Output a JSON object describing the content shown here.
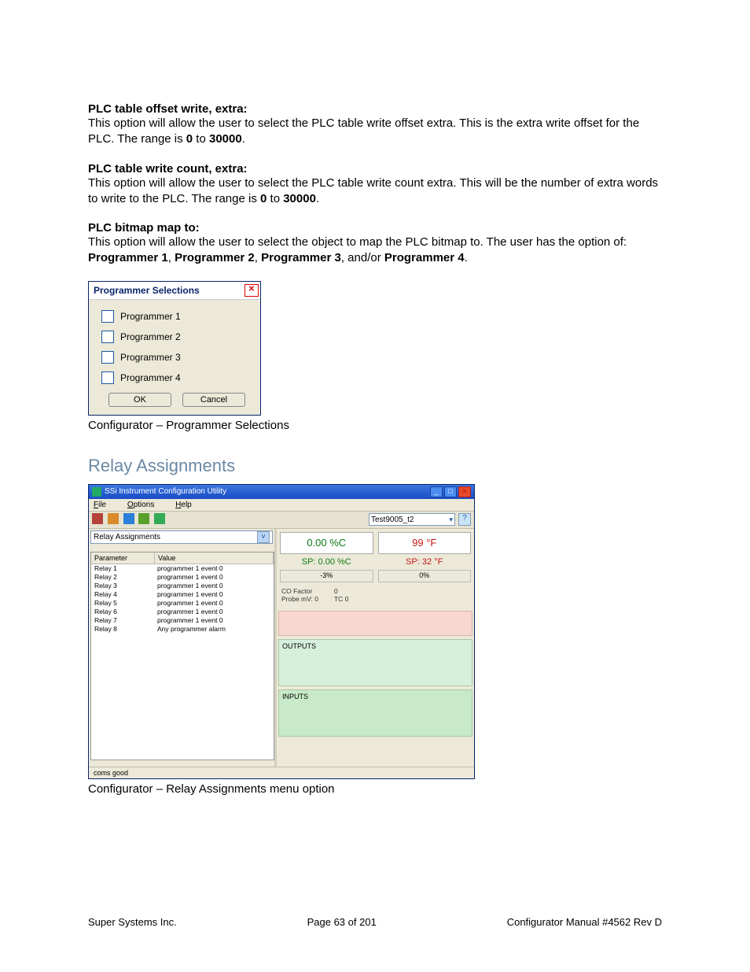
{
  "sections": {
    "s1_head": "PLC table offset write, extra:",
    "s1_body_a": "This option will allow the user to select the PLC table write offset extra.  This is the extra write offset for the PLC.  The range is ",
    "s1_b1": "0",
    "s1_mid": " to ",
    "s1_b2": "30000",
    "s2_head": "PLC table write count, extra:",
    "s2_body_a": "This option will allow the user to select the PLC table write count extra.  This will be the number of extra words to write to the PLC.  The range is ",
    "s2_b1": "0",
    "s2_b2": "30000",
    "s3_head": "PLC bitmap map to:",
    "s3_body_a": "This option will allow the user to select the object to map the PLC bitmap to.  The user has the option of: ",
    "s3_p1": "Programmer 1",
    "s3_p2": "Programmer 2",
    "s3_p3": "Programmer 3",
    "s3_and": ", and/or ",
    "s3_p4": "Programmer 4"
  },
  "progDialog": {
    "title": "Programmer Selections",
    "items": [
      "Programmer 1",
      "Programmer 2",
      "Programmer 3",
      "Programmer 4"
    ],
    "ok": "OK",
    "cancel": "Cancel",
    "caption": "Configurator – Programmer Selections"
  },
  "relayTitle": "Relay Assignments",
  "ssi": {
    "title": "SSi Instrument Configuration Utility",
    "menu": {
      "file": "File",
      "options": "Options",
      "help": "Help"
    },
    "toolbarCombo": "Test9005_t2",
    "leftCombo": "Relay Assignments",
    "table": {
      "h1": "Parameter",
      "h2": "Value",
      "rows": [
        {
          "p": "Relay 1",
          "v": "programmer 1 event 0"
        },
        {
          "p": "Relay 2",
          "v": "programmer 1 event 0"
        },
        {
          "p": "Relay 3",
          "v": "programmer 1 event 0"
        },
        {
          "p": "Relay 4",
          "v": "programmer 1 event 0"
        },
        {
          "p": "Relay 5",
          "v": "programmer 1 event 0"
        },
        {
          "p": "Relay 6",
          "v": "programmer 1 event 0"
        },
        {
          "p": "Relay 7",
          "v": "programmer 1 event 0"
        },
        {
          "p": "Relay 8",
          "v": "Any programmer alarm"
        }
      ]
    },
    "pv1": "0.00 %C",
    "pv2": "99 °F",
    "sp1": "SP: 0.00 %C",
    "sp2": "SP: 32 °F",
    "pct1": "-3%",
    "pct2": "0%",
    "info_l": "CO Factor\nProbe mV: 0",
    "info_r": "0\nTC 0",
    "outputs": "OUTPUTS",
    "inputs": "INPUTS",
    "status": "coms good",
    "caption": "Configurator – Relay Assignments menu option"
  },
  "footer": {
    "left": "Super Systems Inc.",
    "center": "Page 63 of 201",
    "right": "Configurator Manual #4562 Rev D"
  }
}
